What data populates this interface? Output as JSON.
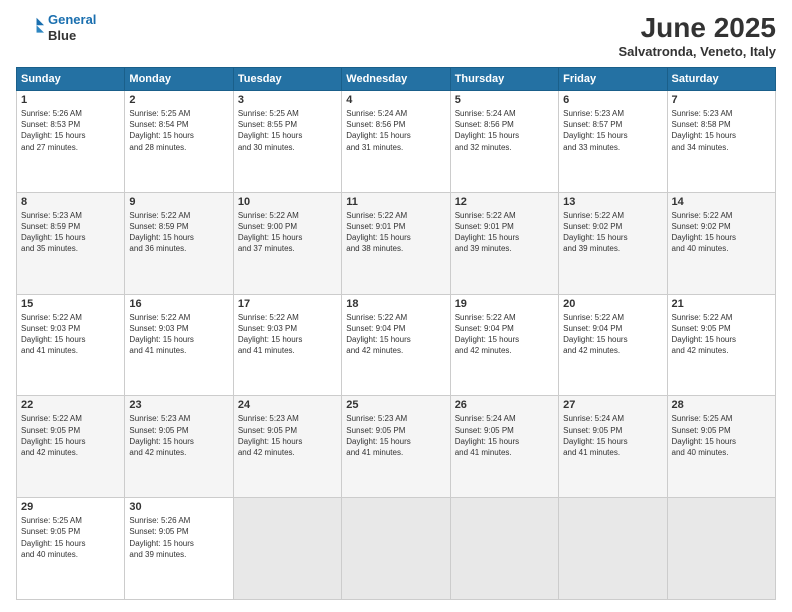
{
  "header": {
    "logo_line1": "General",
    "logo_line2": "Blue",
    "month": "June 2025",
    "location": "Salvatronda, Veneto, Italy"
  },
  "weekdays": [
    "Sunday",
    "Monday",
    "Tuesday",
    "Wednesday",
    "Thursday",
    "Friday",
    "Saturday"
  ],
  "weeks": [
    [
      {
        "day": "1",
        "info": "Sunrise: 5:26 AM\nSunset: 8:53 PM\nDaylight: 15 hours\nand 27 minutes."
      },
      {
        "day": "2",
        "info": "Sunrise: 5:25 AM\nSunset: 8:54 PM\nDaylight: 15 hours\nand 28 minutes."
      },
      {
        "day": "3",
        "info": "Sunrise: 5:25 AM\nSunset: 8:55 PM\nDaylight: 15 hours\nand 30 minutes."
      },
      {
        "day": "4",
        "info": "Sunrise: 5:24 AM\nSunset: 8:56 PM\nDaylight: 15 hours\nand 31 minutes."
      },
      {
        "day": "5",
        "info": "Sunrise: 5:24 AM\nSunset: 8:56 PM\nDaylight: 15 hours\nand 32 minutes."
      },
      {
        "day": "6",
        "info": "Sunrise: 5:23 AM\nSunset: 8:57 PM\nDaylight: 15 hours\nand 33 minutes."
      },
      {
        "day": "7",
        "info": "Sunrise: 5:23 AM\nSunset: 8:58 PM\nDaylight: 15 hours\nand 34 minutes."
      }
    ],
    [
      {
        "day": "8",
        "info": "Sunrise: 5:23 AM\nSunset: 8:59 PM\nDaylight: 15 hours\nand 35 minutes."
      },
      {
        "day": "9",
        "info": "Sunrise: 5:22 AM\nSunset: 8:59 PM\nDaylight: 15 hours\nand 36 minutes."
      },
      {
        "day": "10",
        "info": "Sunrise: 5:22 AM\nSunset: 9:00 PM\nDaylight: 15 hours\nand 37 minutes."
      },
      {
        "day": "11",
        "info": "Sunrise: 5:22 AM\nSunset: 9:01 PM\nDaylight: 15 hours\nand 38 minutes."
      },
      {
        "day": "12",
        "info": "Sunrise: 5:22 AM\nSunset: 9:01 PM\nDaylight: 15 hours\nand 39 minutes."
      },
      {
        "day": "13",
        "info": "Sunrise: 5:22 AM\nSunset: 9:02 PM\nDaylight: 15 hours\nand 39 minutes."
      },
      {
        "day": "14",
        "info": "Sunrise: 5:22 AM\nSunset: 9:02 PM\nDaylight: 15 hours\nand 40 minutes."
      }
    ],
    [
      {
        "day": "15",
        "info": "Sunrise: 5:22 AM\nSunset: 9:03 PM\nDaylight: 15 hours\nand 41 minutes."
      },
      {
        "day": "16",
        "info": "Sunrise: 5:22 AM\nSunset: 9:03 PM\nDaylight: 15 hours\nand 41 minutes."
      },
      {
        "day": "17",
        "info": "Sunrise: 5:22 AM\nSunset: 9:03 PM\nDaylight: 15 hours\nand 41 minutes."
      },
      {
        "day": "18",
        "info": "Sunrise: 5:22 AM\nSunset: 9:04 PM\nDaylight: 15 hours\nand 42 minutes."
      },
      {
        "day": "19",
        "info": "Sunrise: 5:22 AM\nSunset: 9:04 PM\nDaylight: 15 hours\nand 42 minutes."
      },
      {
        "day": "20",
        "info": "Sunrise: 5:22 AM\nSunset: 9:04 PM\nDaylight: 15 hours\nand 42 minutes."
      },
      {
        "day": "21",
        "info": "Sunrise: 5:22 AM\nSunset: 9:05 PM\nDaylight: 15 hours\nand 42 minutes."
      }
    ],
    [
      {
        "day": "22",
        "info": "Sunrise: 5:22 AM\nSunset: 9:05 PM\nDaylight: 15 hours\nand 42 minutes."
      },
      {
        "day": "23",
        "info": "Sunrise: 5:23 AM\nSunset: 9:05 PM\nDaylight: 15 hours\nand 42 minutes."
      },
      {
        "day": "24",
        "info": "Sunrise: 5:23 AM\nSunset: 9:05 PM\nDaylight: 15 hours\nand 42 minutes."
      },
      {
        "day": "25",
        "info": "Sunrise: 5:23 AM\nSunset: 9:05 PM\nDaylight: 15 hours\nand 41 minutes."
      },
      {
        "day": "26",
        "info": "Sunrise: 5:24 AM\nSunset: 9:05 PM\nDaylight: 15 hours\nand 41 minutes."
      },
      {
        "day": "27",
        "info": "Sunrise: 5:24 AM\nSunset: 9:05 PM\nDaylight: 15 hours\nand 41 minutes."
      },
      {
        "day": "28",
        "info": "Sunrise: 5:25 AM\nSunset: 9:05 PM\nDaylight: 15 hours\nand 40 minutes."
      }
    ],
    [
      {
        "day": "29",
        "info": "Sunrise: 5:25 AM\nSunset: 9:05 PM\nDaylight: 15 hours\nand 40 minutes."
      },
      {
        "day": "30",
        "info": "Sunrise: 5:26 AM\nSunset: 9:05 PM\nDaylight: 15 hours\nand 39 minutes."
      },
      {
        "day": "",
        "info": ""
      },
      {
        "day": "",
        "info": ""
      },
      {
        "day": "",
        "info": ""
      },
      {
        "day": "",
        "info": ""
      },
      {
        "day": "",
        "info": ""
      }
    ]
  ]
}
